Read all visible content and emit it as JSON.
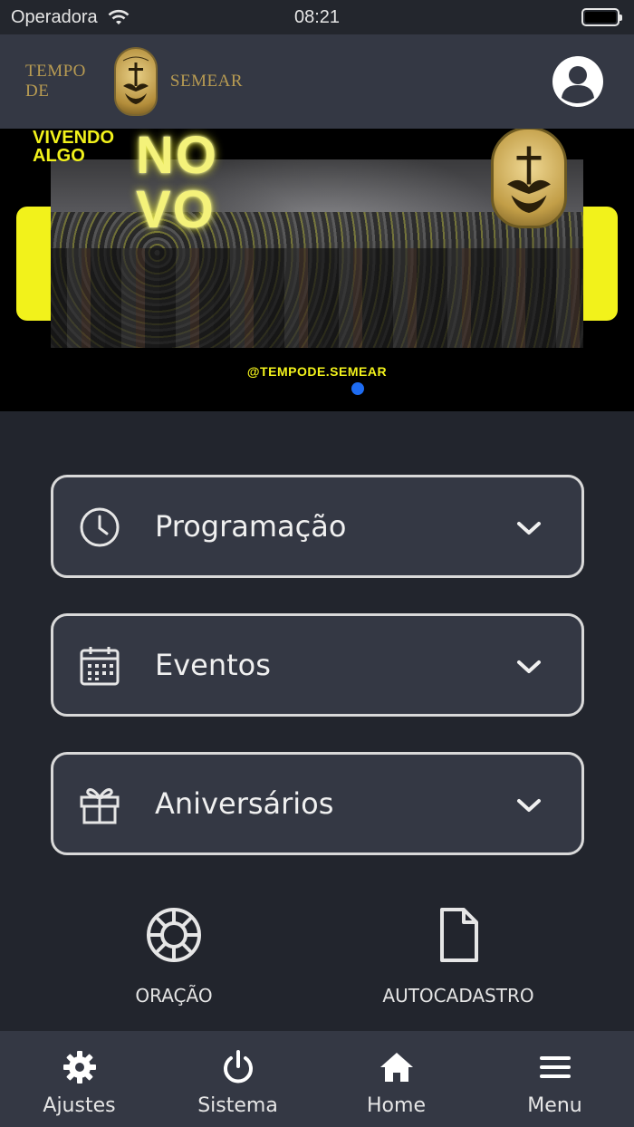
{
  "status_bar": {
    "carrier": "Operadora",
    "time": "08:21"
  },
  "header": {
    "logo_left": "TEMPO DE",
    "logo_right": "SEMEAR",
    "logo_badge_text": "TEMPO DE SEMEAR",
    "profile_icon": "account-circle-icon"
  },
  "banner": {
    "headline_top": "VIVENDO",
    "headline_bottom": "ALGO",
    "neon_text_1": "NO",
    "neon_text_2": "VO",
    "badge_text": "TEMPO DE SEMEAR",
    "handle": "@TEMPODE.SEMEAR",
    "carousel_index": 1,
    "carousel_count": 1
  },
  "accordions": [
    {
      "label": "Programação",
      "icon": "clock-icon"
    },
    {
      "label": "Eventos",
      "icon": "calendar-icon"
    },
    {
      "label": "Aniversários",
      "icon": "gift-icon"
    }
  ],
  "shortcuts": [
    {
      "label": "ORAÇÃO",
      "icon": "lifebuoy-icon"
    },
    {
      "label": "AUTOCADASTRO",
      "icon": "document-icon"
    }
  ],
  "tabbar": [
    {
      "label": "Ajustes",
      "icon": "gear-icon"
    },
    {
      "label": "Sistema",
      "icon": "power-icon"
    },
    {
      "label": "Home",
      "icon": "home-icon"
    },
    {
      "label": "Menu",
      "icon": "hamburger-menu-icon"
    }
  ],
  "colors": {
    "background": "#22252d",
    "surface": "#343844",
    "accent_yellow": "#f2f21b",
    "carousel_dot": "#1e6cf2",
    "logo_gold": "#b89b52"
  }
}
